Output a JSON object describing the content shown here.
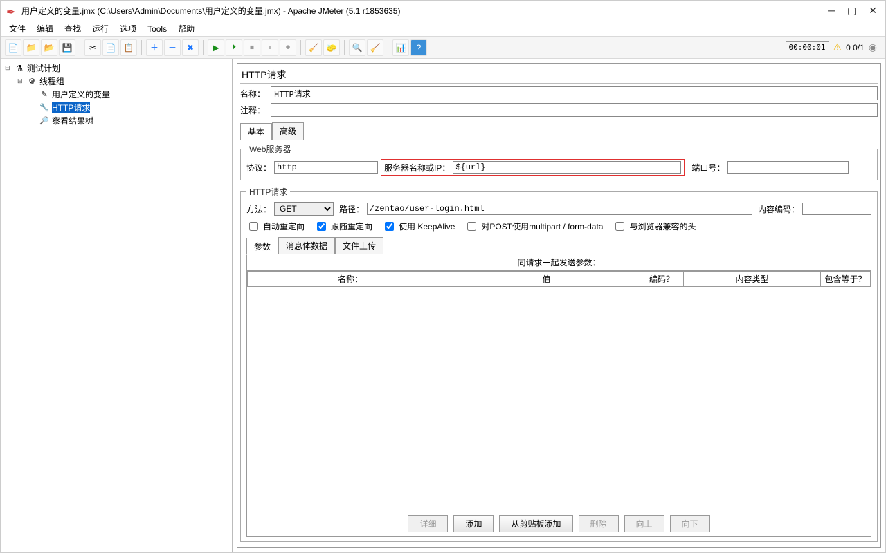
{
  "title": "用户定义的变量.jmx (C:\\Users\\Admin\\Documents\\用户定义的变量.jmx) - Apache JMeter (5.1 r1853635)",
  "menu": [
    "文件",
    "编辑",
    "查找",
    "运行",
    "选项",
    "Tools",
    "帮助"
  ],
  "status_time": "00:00:01",
  "status_counter": "0  0/1",
  "tree": {
    "test_plan": "测试计划",
    "thread_group": "线程组",
    "user_vars": "用户定义的变量",
    "http_request": "HTTP请求",
    "results_tree": "察看结果树"
  },
  "panel": {
    "title": "HTTP请求",
    "name_label": "名称：",
    "name_value": "HTTP请求",
    "comment_label": "注释：",
    "tab_basic": "基本",
    "tab_advanced": "高级",
    "web_server_legend": "Web服务器",
    "protocol_label": "协议：",
    "protocol_value": "http",
    "server_label": "服务器名称或IP：",
    "server_value": "${url}",
    "port_label": "端口号：",
    "http_request_legend": "HTTP请求",
    "method_label": "方法：",
    "method_value": "GET",
    "path_label": "路径：",
    "path_value": "/zentao/user-login.html",
    "encoding_label": "内容编码：",
    "cb_auto_redirect": "自动重定向",
    "cb_follow_redirect": "跟随重定向",
    "cb_keepalive": "使用 KeepAlive",
    "cb_multipart": "对POST使用multipart / form-data",
    "cb_browser_headers": "与浏览器兼容的头",
    "subtab_params": "参数",
    "subtab_body": "消息体数据",
    "subtab_files": "文件上传",
    "params_title": "同请求一起发送参数：",
    "col_name": "名称：",
    "col_value": "值",
    "col_encode": "编码？",
    "col_content_type": "内容类型",
    "col_include_equals": "包含等于？",
    "btn_detail": "详细",
    "btn_add": "添加",
    "btn_clipboard": "从剪贴板添加",
    "btn_delete": "删除",
    "btn_up": "向上",
    "btn_down": "向下"
  }
}
